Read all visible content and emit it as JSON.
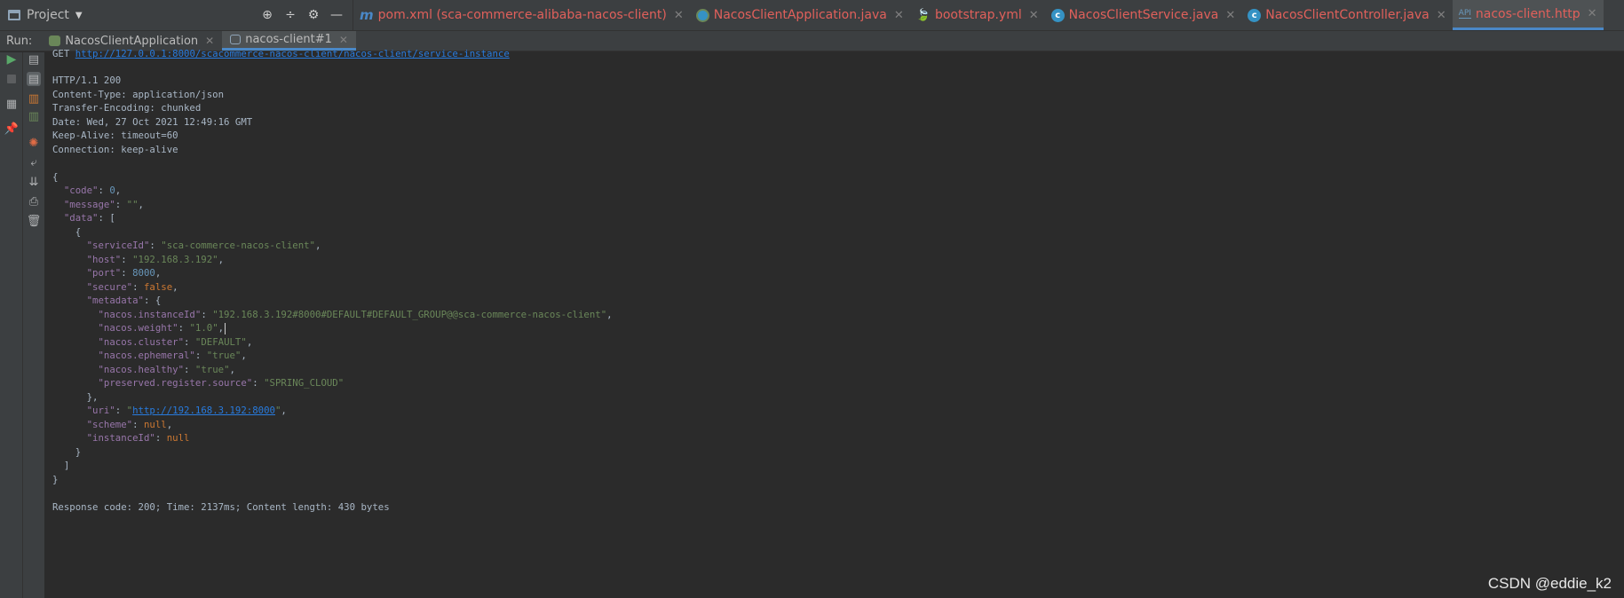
{
  "project": {
    "label": "Project"
  },
  "editor_tabs": [
    {
      "label": "pom.xml (sca-commerce-alibaba-nacos-client)",
      "icon": "maven-icon"
    },
    {
      "label": "NacosClientApplication.java",
      "icon": "spring-class-icon"
    },
    {
      "label": "bootstrap.yml",
      "icon": "yaml-icon"
    },
    {
      "label": "NacosClientService.java",
      "icon": "class-icon"
    },
    {
      "label": "NacosClientController.java",
      "icon": "class-icon"
    },
    {
      "label": "nacos-client.http",
      "icon": "http-file-icon"
    }
  ],
  "run": {
    "label": "Run:",
    "tabs": [
      {
        "label": "NacosClientApplication"
      },
      {
        "label": "nacos-client#1"
      }
    ]
  },
  "request": {
    "method": "GET",
    "url": "http://127.0.0.1:8000/scacommerce-nacos-client/nacos-client/service-instance"
  },
  "response_headers": [
    "HTTP/1.1 200",
    "Content-Type: application/json",
    "Transfer-Encoding: chunked",
    "Date: Wed, 27 Oct 2021 12:49:16 GMT",
    "Keep-Alive: timeout=60",
    "Connection: keep-alive"
  ],
  "body": {
    "code": "0",
    "message": "\"\"",
    "serviceId": "\"sca-commerce-nacos-client\"",
    "host": "\"192.168.3.192\"",
    "port": "8000",
    "secure": "false",
    "instanceIdMeta": "\"192.168.3.192#8000#DEFAULT#DEFAULT_GROUP@@sca-commerce-nacos-client\"",
    "weight": "\"1.0\"",
    "cluster": "\"DEFAULT\"",
    "ephemeral": "\"true\"",
    "healthy": "\"true\"",
    "source": "\"SPRING_CLOUD\"",
    "uri": "http://192.168.3.192:8000",
    "scheme": "null",
    "instanceId": "null"
  },
  "summary": "Response code: 200; Time: 2137ms; Content length: 430 bytes",
  "watermark": "CSDN @eddie_k2"
}
